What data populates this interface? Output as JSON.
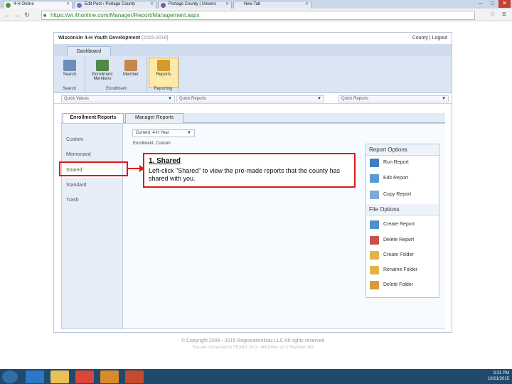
{
  "browser": {
    "tabs": [
      {
        "label": "4-H Online"
      },
      {
        "label": "Edit Post ‹ Portage County"
      },
      {
        "label": "Portage County | Univers"
      },
      {
        "label": "New Tab"
      }
    ],
    "url": "https://wi.4honline.com/Manager/Report/Management.aspx"
  },
  "site": {
    "title": "Wisconsin 4-H Youth Development",
    "year_range": "[2015-2016]",
    "header_links": "County | Logout",
    "ribbon_tab": "Dashboard",
    "ribbon": {
      "search_label": "Search",
      "enrollment_label": "Enrollment Members",
      "member_label": "Member",
      "reports_label": "Reports",
      "group_search": "Search",
      "group_enrollment": "Enrollment",
      "group_reporting": "Reporting"
    },
    "quick": {
      "values": "Quick Values",
      "reports": "Quick Reports",
      "reports2": "Quick Reports"
    },
    "subtabs": {
      "enrollment": "Enrollment Reports",
      "manager": "Manager Reports"
    },
    "leftnav": [
      "Custom",
      "Memorized",
      "Shared",
      "Standard",
      "Trash"
    ],
    "folder_select": "Current: 4-H Year",
    "breadcrumb": "Enrollment: Custom",
    "report_options": {
      "header": "Report Options",
      "items": [
        "Run Report",
        "Edit Report",
        "Copy Report"
      ]
    },
    "file_options": {
      "header": "File Options",
      "items": [
        "Create Report",
        "Delete Report",
        "Create Folder",
        "Rename Folder",
        "Delete Folder"
      ]
    },
    "footer_copyright": "© Copyright 2006 - 2015 RegistrationMax LLC All rights reserved",
    "footer_connected": "You are connected to TEAM1.10.0 - 4HOnline v1.3 Revision 082"
  },
  "callout": {
    "title": "1. Shared",
    "body": "Left-click \"Shared\" to view the pre-made reports that the county has shared with you."
  },
  "taskbar": {
    "time": "3:21 PM",
    "date": "10/21/2015"
  },
  "colors": {
    "callout_red": "#e01818",
    "ribbon_blue": "#dbe5f3",
    "taskbar": "#1f4a6e"
  }
}
